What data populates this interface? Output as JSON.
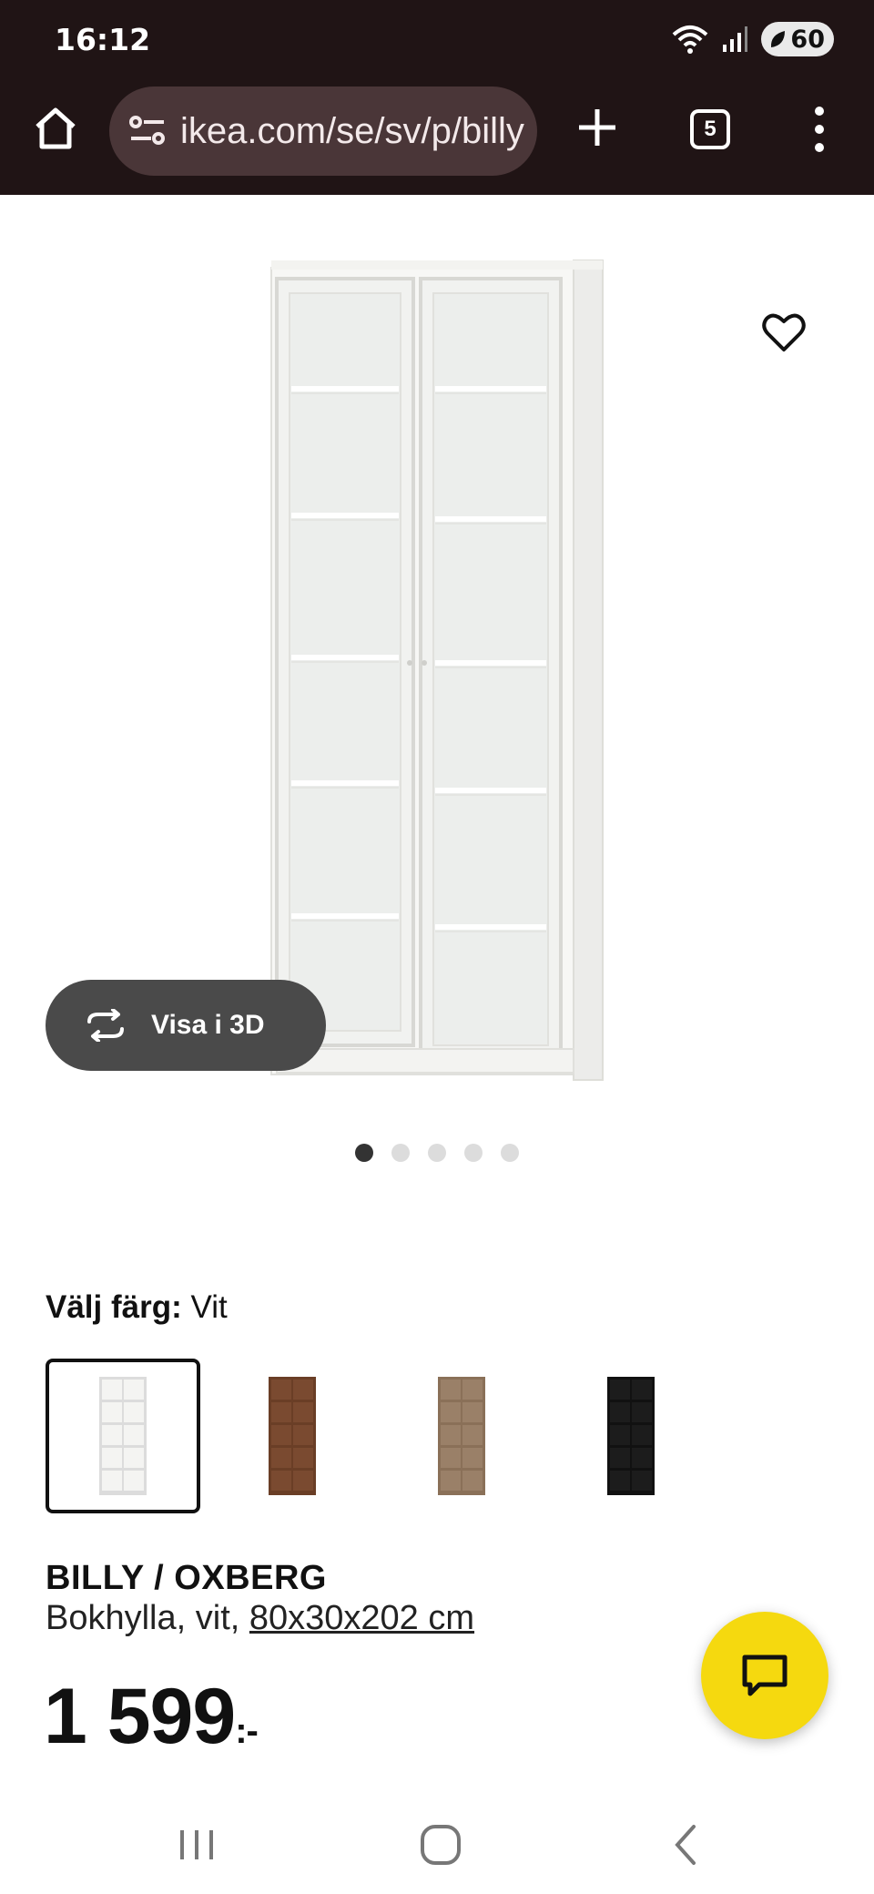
{
  "status": {
    "time": "16:12",
    "battery": "60"
  },
  "browser": {
    "url": "ikea.com/se/sv/p/billy",
    "tab_count": "5"
  },
  "gallery": {
    "view3d_label": "Visa i 3D",
    "slide_count": 5,
    "active_slide": 1
  },
  "color_picker": {
    "label": "Välj färg:",
    "selected_value": "Vit",
    "swatches": [
      {
        "name": "white",
        "color": "#f4f4f2",
        "frame": "#dcdcdc"
      },
      {
        "name": "brown",
        "color": "#7a4a30",
        "frame": "#6a3e26"
      },
      {
        "name": "oak",
        "color": "#9a8068",
        "frame": "#8a7058"
      },
      {
        "name": "black",
        "color": "#1c1c1c",
        "frame": "#111111"
      }
    ]
  },
  "product": {
    "name": "BILLY / OXBERG",
    "description_prefix": "Bokhylla, vit, ",
    "dimensions": "80x30x202 cm",
    "price": "1 599",
    "price_suffix": ":-"
  },
  "colors": {
    "header_bg": "#201415",
    "url_bg": "#4a3638",
    "chat_yellow": "#f5d90f"
  }
}
